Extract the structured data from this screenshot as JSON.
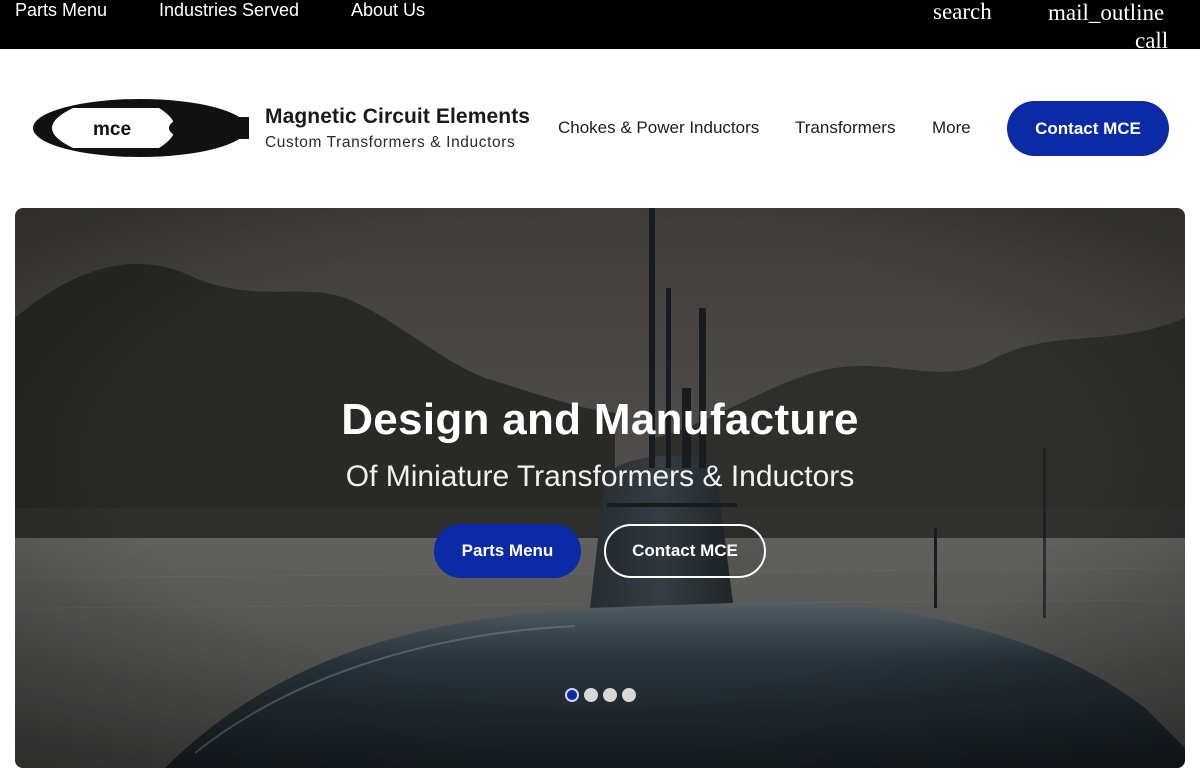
{
  "topbar": {
    "links": [
      "Parts Menu",
      "Industries Served",
      "About Us"
    ],
    "icons": {
      "search": "search",
      "mail": "mail_outline",
      "call": "call"
    }
  },
  "brand": {
    "logo_text": "mce",
    "name": "Magnetic Circuit Elements",
    "tagline": "Custom Transformers & Inductors"
  },
  "nav": {
    "items": [
      "Chokes & Power Inductors",
      "Transformers",
      "More"
    ],
    "contact_button": "Contact MCE"
  },
  "hero": {
    "title": "Design and Manufacture",
    "subtitle": "Of Miniature Transformers & Inductors",
    "primary_button": "Parts Menu",
    "secondary_button": "Contact MCE",
    "slide_count": 4,
    "active_slide": 1
  },
  "colors": {
    "topbar_bg": "#000000",
    "accent": "#0a2aa6",
    "dot_inactive": "#d7d7d7"
  }
}
